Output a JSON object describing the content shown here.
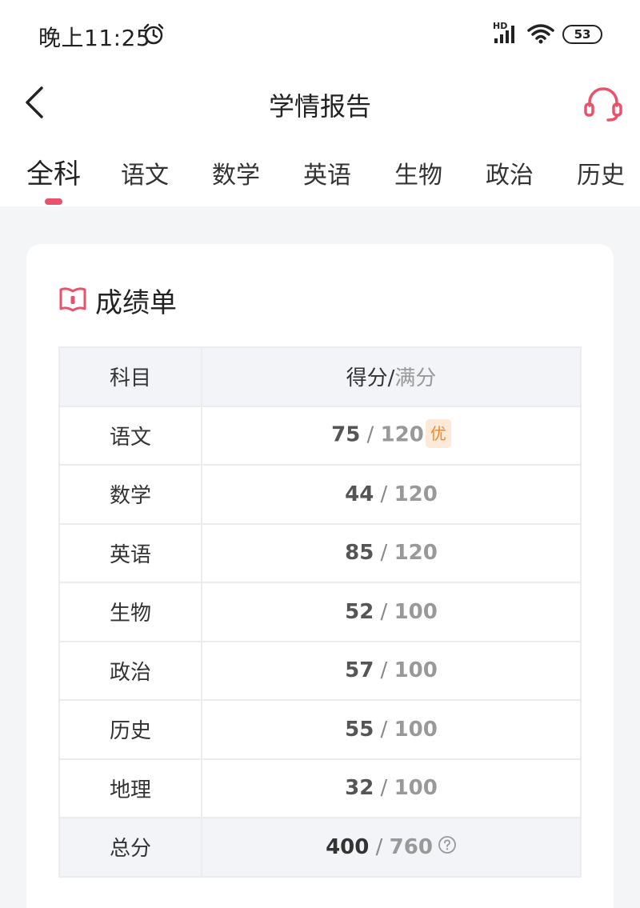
{
  "status_bar": {
    "time": "晚上11:25",
    "network": "HD",
    "battery": "53"
  },
  "header": {
    "title": "学情报告"
  },
  "tabs": [
    {
      "label": "全科",
      "active": true
    },
    {
      "label": "语文",
      "active": false
    },
    {
      "label": "数学",
      "active": false
    },
    {
      "label": "英语",
      "active": false
    },
    {
      "label": "生物",
      "active": false
    },
    {
      "label": "政治",
      "active": false
    },
    {
      "label": "历史",
      "active": false
    }
  ],
  "report_card": {
    "title": "成绩单",
    "header": {
      "subject": "科目",
      "score": "得分",
      "slash": "/",
      "full": "满分"
    },
    "rows": [
      {
        "subject": "语文",
        "score": "75",
        "full": "120",
        "badge": "优"
      },
      {
        "subject": "数学",
        "score": "44",
        "full": "120"
      },
      {
        "subject": "英语",
        "score": "85",
        "full": "120"
      },
      {
        "subject": "生物",
        "score": "52",
        "full": "100"
      },
      {
        "subject": "政治",
        "score": "57",
        "full": "100"
      },
      {
        "subject": "历史",
        "score": "55",
        "full": "100"
      },
      {
        "subject": "地理",
        "score": "32",
        "full": "100"
      }
    ],
    "total": {
      "subject": "总分",
      "score": "400",
      "full": "760"
    }
  },
  "colors": {
    "accent": "#e8526a",
    "badge_bg": "#fde9d8",
    "badge_text": "#f08a2c"
  },
  "icons": [
    "alarm-icon",
    "signal-icon",
    "wifi-icon",
    "back-icon",
    "headset-icon",
    "book-icon",
    "help-icon"
  ]
}
